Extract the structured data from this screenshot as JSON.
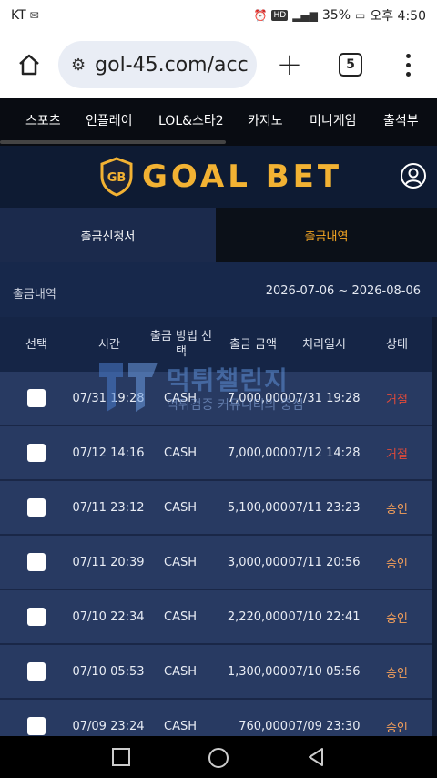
{
  "status_bar": {
    "carrier": "KT",
    "battery": "35%",
    "time": "오후 4:50"
  },
  "browser": {
    "url": "gol-45.com/acc",
    "tab_count": "5"
  },
  "nav": {
    "items": [
      "스포츠",
      "인플레이",
      "LOL&스타2",
      "카지노",
      "미니게임",
      "출석부"
    ]
  },
  "header": {
    "logo_text": "GOAL BET",
    "logo_emblem": "GB"
  },
  "sub_tabs": {
    "request_label": "출금신청서",
    "history_label": "출금내역"
  },
  "info": {
    "label": "출금내역",
    "date_range": "2026-07-06 ~ 2026-08-06"
  },
  "table": {
    "headers": {
      "select": "선택",
      "time": "시간",
      "method": "출금 방법 선택",
      "amount": "출금 금액",
      "processed": "처리일시",
      "status": "상태"
    },
    "rows": [
      {
        "time": "07/31 19:28",
        "method": "CASH",
        "amount": "7,000,000",
        "processed": "07/31 19:28",
        "status": "거절",
        "status_type": "rejected"
      },
      {
        "time": "07/12 14:16",
        "method": "CASH",
        "amount": "7,000,000",
        "processed": "07/12 14:28",
        "status": "거절",
        "status_type": "rejected"
      },
      {
        "time": "07/11 23:12",
        "method": "CASH",
        "amount": "5,100,000",
        "processed": "07/11 23:23",
        "status": "승인",
        "status_type": "approved"
      },
      {
        "time": "07/11 20:39",
        "method": "CASH",
        "amount": "3,000,000",
        "processed": "07/11 20:56",
        "status": "승인",
        "status_type": "approved"
      },
      {
        "time": "07/10 22:34",
        "method": "CASH",
        "amount": "2,220,000",
        "processed": "07/10 22:41",
        "status": "승인",
        "status_type": "approved"
      },
      {
        "time": "07/10 05:53",
        "method": "CASH",
        "amount": "1,300,000",
        "processed": "07/10 05:56",
        "status": "승인",
        "status_type": "approved"
      },
      {
        "time": "07/09 23:24",
        "method": "CASH",
        "amount": "760,000",
        "processed": "07/09 23:30",
        "status": "승인",
        "status_type": "approved"
      }
    ]
  },
  "watermark": {
    "title": "먹튀챌린지",
    "subtitle": "먹튀검증 커뮤니티의 중심"
  },
  "colors": {
    "accent": "#f5a623",
    "rejected": "#e04a3a",
    "approved": "#f5a05a",
    "row_bg": "#283a62",
    "header_bg": "#0e1b33"
  }
}
